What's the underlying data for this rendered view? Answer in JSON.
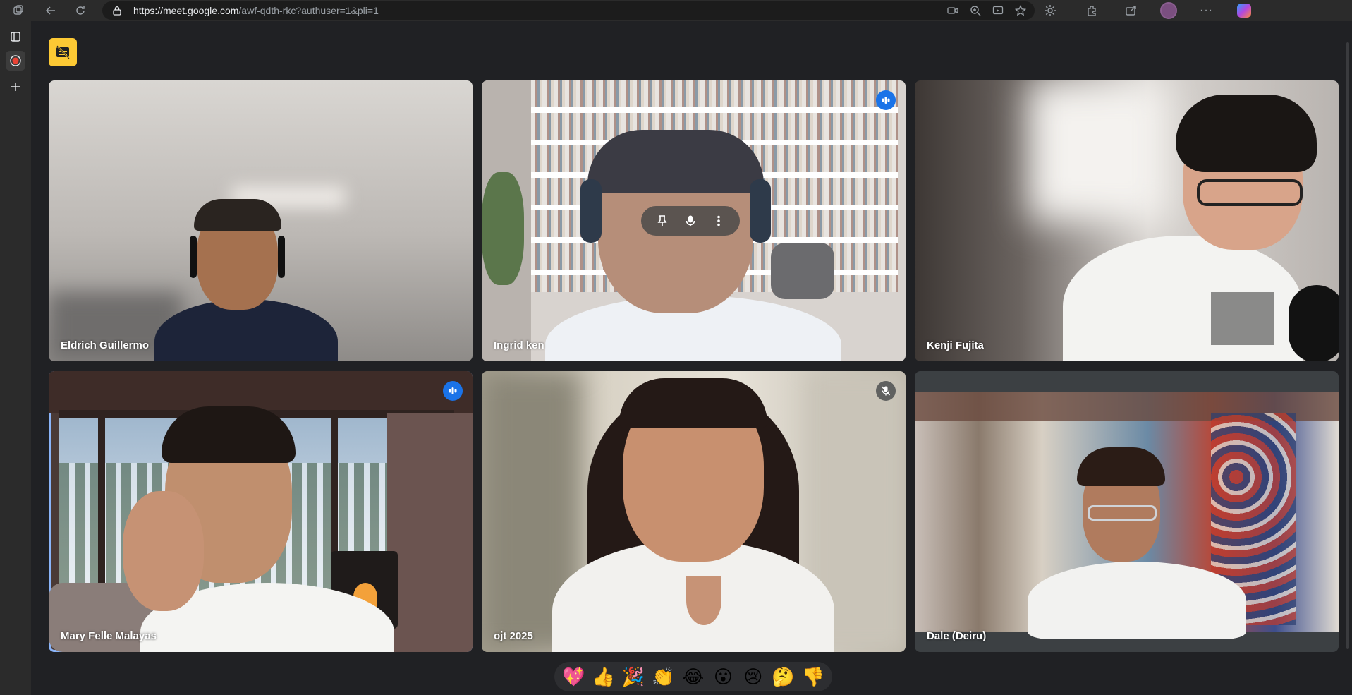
{
  "browser": {
    "url_host": "https://meet.google.com",
    "url_path": "/awf-qdth-rkc?authuser=1&pli=1"
  },
  "participants": [
    {
      "name": "Eldrich Guillermo",
      "status": "none"
    },
    {
      "name": "Ingrid ken",
      "status": "speaking"
    },
    {
      "name": "Kenji Fujita",
      "status": "none"
    },
    {
      "name": "Mary Felle Malayas",
      "status": "speaking"
    },
    {
      "name": "ojt 2025",
      "status": "muted"
    },
    {
      "name": "Dale (Deiru)",
      "status": "none"
    }
  ],
  "reactions": [
    "💖",
    "👍",
    "🎉",
    "👏",
    "😂",
    "😮",
    "😢",
    "🤔",
    "👎"
  ],
  "colors": {
    "accent_blue": "#1a73e8",
    "captions_yellow": "#fcc934",
    "active_outline": "#8ab4f8",
    "stage_bg": "#202124"
  },
  "icons": {
    "captions_off": "captions-off-icon",
    "pin": "pin-icon",
    "mic": "mic-icon",
    "more": "more-vert-icon"
  }
}
